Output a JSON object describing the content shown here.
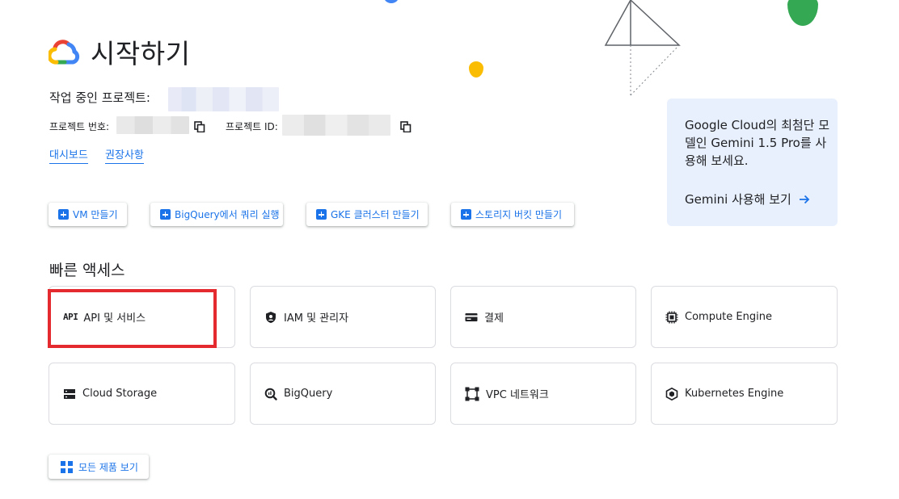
{
  "header": {
    "title": "시작하기"
  },
  "project": {
    "working_label": "작업 중인 프로젝트:",
    "number_label": "프로젝트 번호:",
    "id_label": "프로젝트 ID:"
  },
  "links": {
    "dashboard": "대시보드",
    "recommendations": "권장사항"
  },
  "actions": [
    {
      "label": "VM 만들기"
    },
    {
      "label": "BigQuery에서 쿼리 실행"
    },
    {
      "label": "GKE 클러스터 만들기"
    },
    {
      "label": "스토리지 버킷 만들기"
    }
  ],
  "promo": {
    "text": "Google Cloud의 최첨단 모델인 Gemini 1.5 Pro를 사용해 보세요.",
    "link": "Gemini 사용해 보기"
  },
  "quick_access": {
    "title": "빠른 액세스",
    "items": [
      {
        "label": "API 및 서비스",
        "icon": "api-icon"
      },
      {
        "label": "IAM 및 관리자",
        "icon": "shield-icon"
      },
      {
        "label": "결제",
        "icon": "billing-icon"
      },
      {
        "label": "Compute Engine",
        "icon": "chip-icon"
      },
      {
        "label": "Cloud Storage",
        "icon": "storage-icon"
      },
      {
        "label": "BigQuery",
        "icon": "bigquery-icon"
      },
      {
        "label": "VPC 네트워크",
        "icon": "network-icon"
      },
      {
        "label": "Kubernetes Engine",
        "icon": "kubernetes-icon"
      }
    ],
    "icon_glyph_api": "API"
  },
  "all_products": {
    "label": "모든 제품 보기"
  },
  "colors": {
    "accent": "#1a73e8",
    "highlight": "#e52a2f",
    "promo_bg": "#e8f0fe"
  }
}
